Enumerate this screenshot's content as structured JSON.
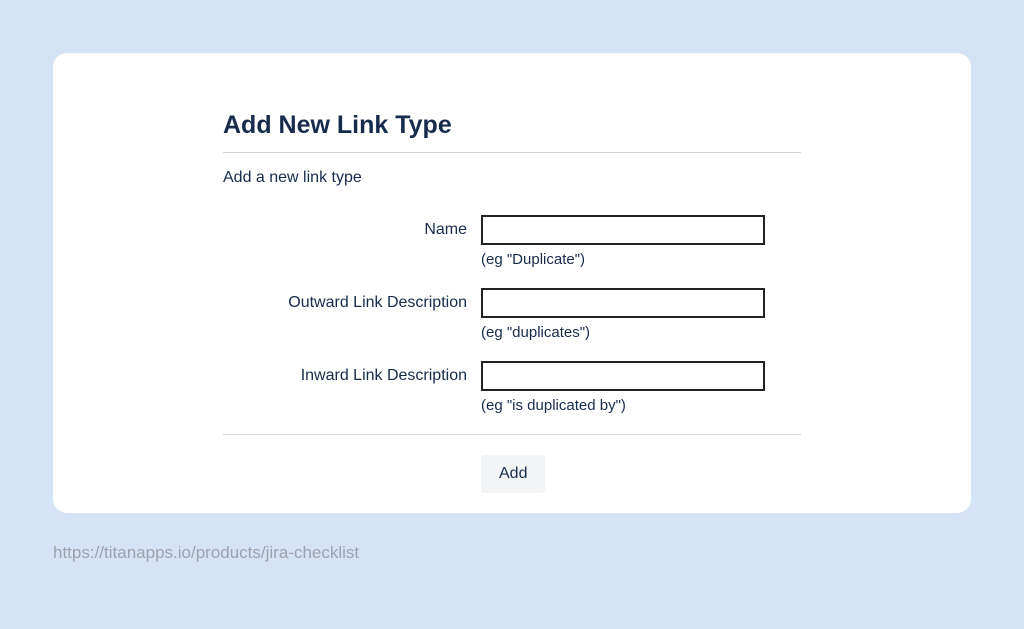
{
  "form": {
    "title": "Add New Link Type",
    "subtitle": "Add a new link type",
    "fields": {
      "name": {
        "label": "Name",
        "value": "",
        "hint": "(eg \"Duplicate\")"
      },
      "outward": {
        "label": "Outward Link Description",
        "value": "",
        "hint": "(eg \"duplicates\")"
      },
      "inward": {
        "label": "Inward Link Description",
        "value": "",
        "hint": "(eg \"is duplicated by\")"
      }
    },
    "submit_label": "Add"
  },
  "footer": {
    "url": "https://titanapps.io/products/jira-checklist"
  }
}
